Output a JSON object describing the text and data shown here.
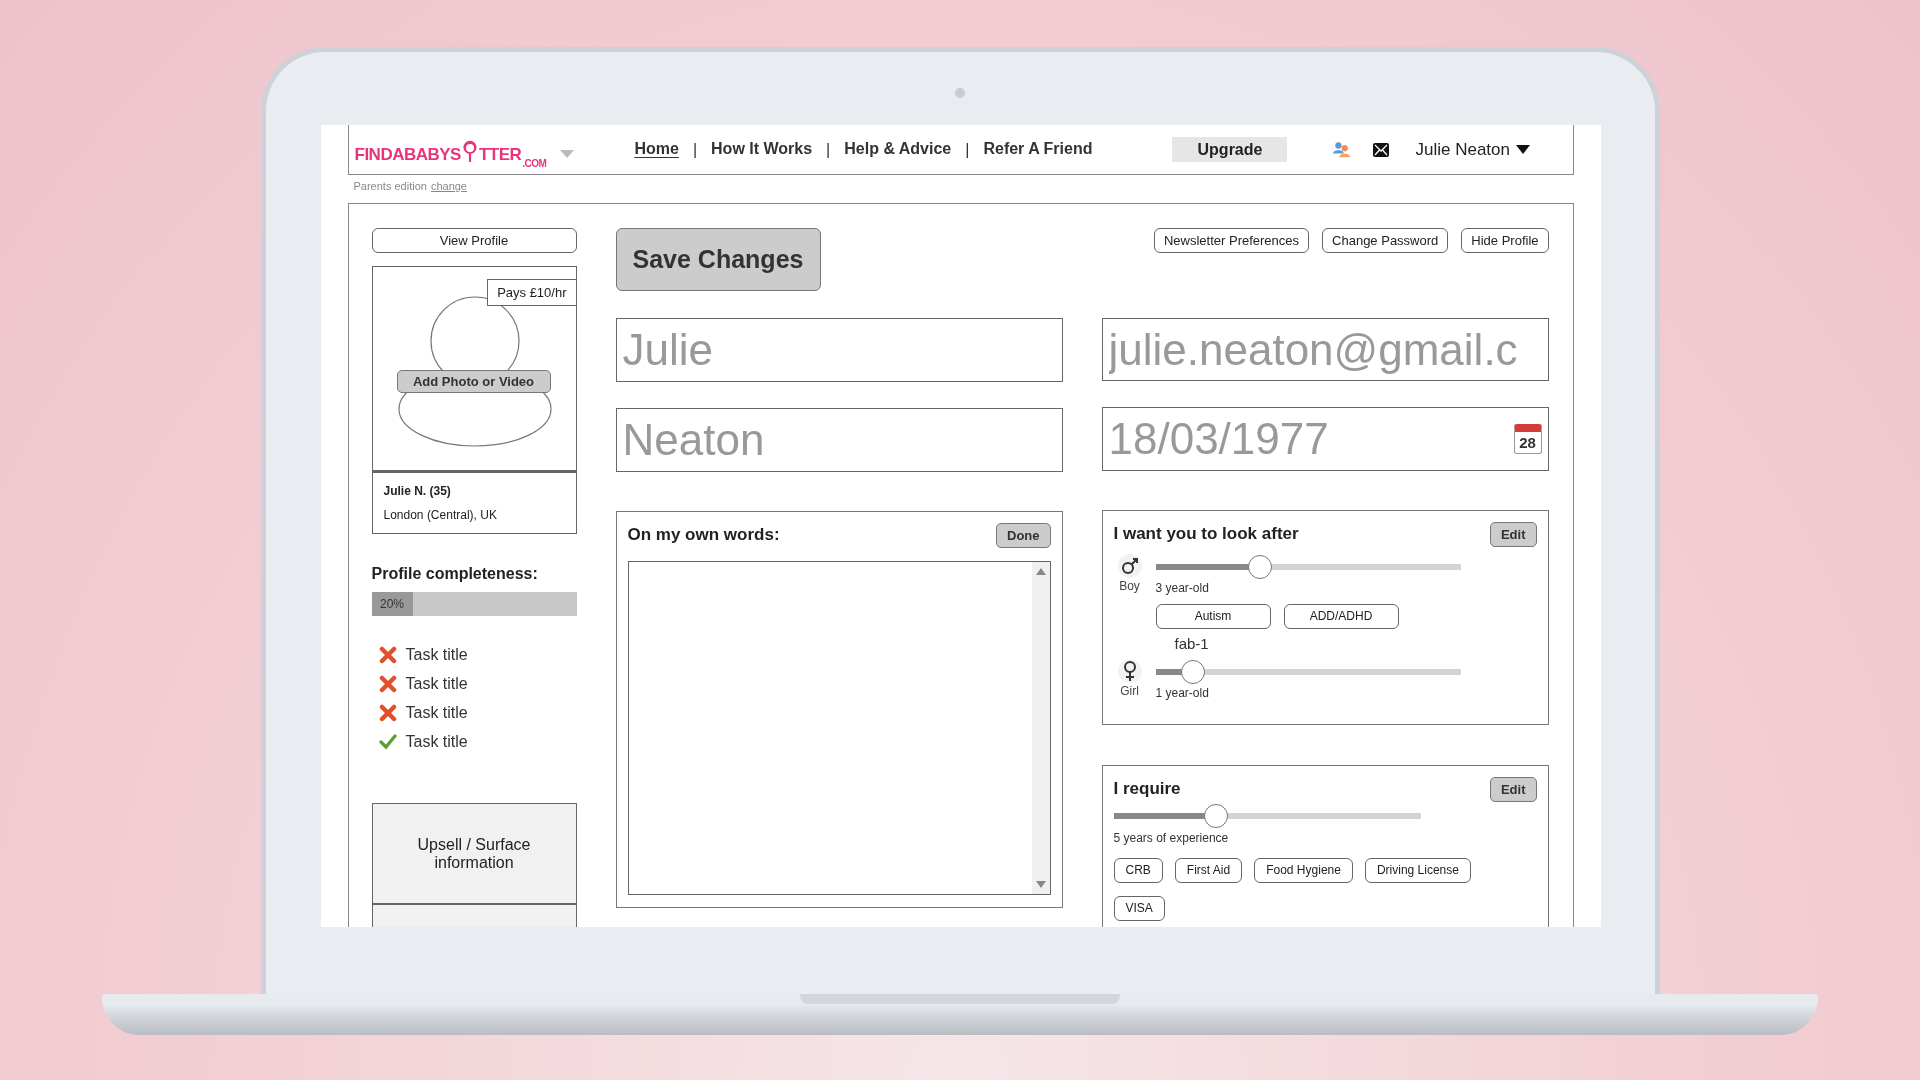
{
  "header": {
    "logo": {
      "before": "FINDABABYS",
      "after": "TTER",
      "suffix": ".COM"
    },
    "nav": [
      {
        "label": "Home",
        "selected": true,
        "separator": "|"
      },
      {
        "label": "How It Works",
        "selected": false,
        "separator": "|"
      },
      {
        "label": "Help & Advice",
        "selected": false,
        "separator": "|"
      },
      {
        "label": "Refer A  Friend",
        "selected": false
      }
    ],
    "upgrade": "Upgrade",
    "user": "Julie Neaton"
  },
  "edition": {
    "text": "Parents edition",
    "link": "change"
  },
  "sidebar": {
    "view_profile": "View Profile",
    "price_badge": "Pays £10/hr",
    "add_photo": "Add Photo or Video",
    "name": "Julie N. (35)",
    "location": "London (Central), UK",
    "completeness": {
      "label": "Profile completeness:",
      "level": 0.2,
      "reading": "20%"
    },
    "tasks": [
      {
        "title": "Task title",
        "done": false
      },
      {
        "title": "Task title",
        "done": false
      },
      {
        "title": "Task title",
        "done": false
      },
      {
        "title": "Task title",
        "done": true
      }
    ],
    "upsell": "Upsell / Surface information"
  },
  "save_button": "Save Changes",
  "account_buttons": [
    "Newsletter Preferences",
    "Change Password",
    "Hide Profile"
  ],
  "fields": {
    "first_name": "Julie",
    "last_name": "Neaton",
    "email": "julie.neaton@gmail.c",
    "birth_date": "18/03/1977",
    "calendar_day": "28"
  },
  "about": {
    "title": "On my own words:",
    "done": "Done"
  },
  "look_after": {
    "title": "I want you to look after",
    "edit": "Edit",
    "children": [
      {
        "kind": "boy",
        "label": "Boy",
        "level": 0.34,
        "age": "3 year-old",
        "tags": [
          "Autism",
          "ADD/ADHD"
        ],
        "note": "fab-1"
      },
      {
        "kind": "girl",
        "label": "Girl",
        "level": 0.12,
        "age": "1 year-old"
      }
    ]
  },
  "requirements": {
    "title": "I require",
    "edit": "Edit",
    "level": 0.33,
    "reading": "5 years of experience",
    "tags": [
      "CRB",
      "First Aid",
      "Food Hygiene",
      "Driving License",
      "VISA"
    ]
  }
}
